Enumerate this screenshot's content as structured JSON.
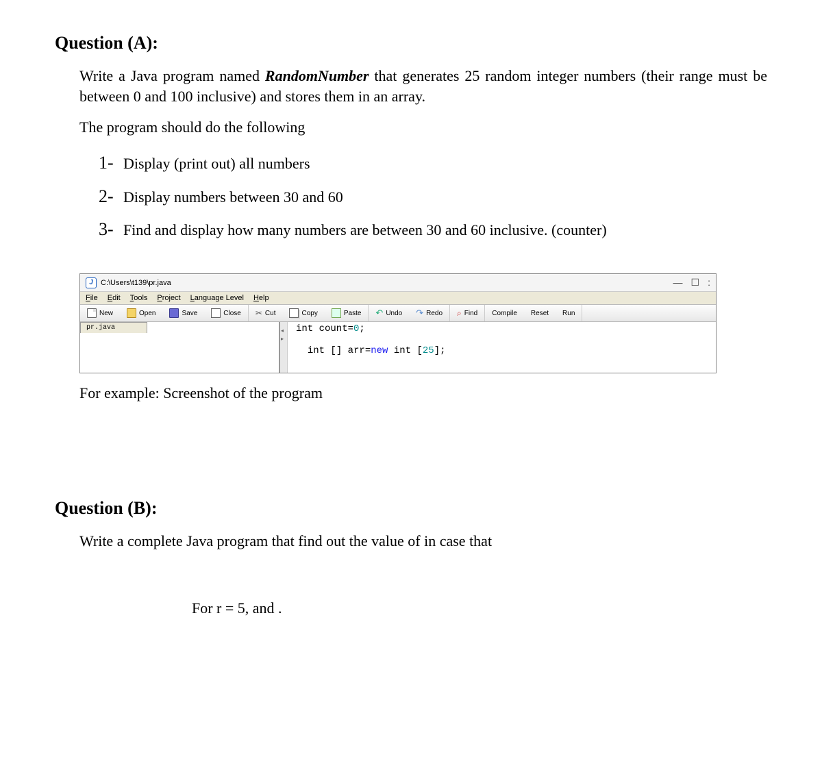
{
  "questionA": {
    "heading": "Question (A):",
    "para1_a": "Write a Java program named ",
    "program_name": "RandomNumber",
    "para1_b": " that generates 25 random integer numbers (their range must be between 0 and 100 inclusive) and stores them in an array.",
    "para2": "The program should do the following",
    "items": [
      {
        "num": "1",
        "text": "Display (print out) all numbers"
      },
      {
        "num": "2",
        "text": "Display numbers between 30 and 60"
      },
      {
        "num": "3",
        "text": "Find and display how many numbers are between 30 and 60 inclusive. (counter)"
      }
    ],
    "caption": "For example: Screenshot of the program"
  },
  "ide": {
    "title_path": "C:\\Users\\t139\\pr.java",
    "menu": [
      "File",
      "Edit",
      "Tools",
      "Project",
      "Language Level",
      "Help"
    ],
    "tools": {
      "new": "New",
      "open": "Open",
      "save": "Save",
      "close": "Close",
      "cut": "Cut",
      "copy": "Copy",
      "paste": "Paste",
      "undo": "Undo",
      "redo": "Redo",
      "find": "Find",
      "compile": "Compile",
      "reset": "Reset",
      "run": "Run"
    },
    "tab_label": "pr.java",
    "code_line1_a": "int count=",
    "code_line1_num": "0",
    "code_line1_b": ";",
    "code_line2_a": "int [] arr=",
    "code_line2_kw": "new",
    "code_line2_b": " int [",
    "code_line2_num": "25",
    "code_line2_c": "];",
    "win_controls": {
      "min": "—",
      "max": "☐",
      "close": ":"
    }
  },
  "questionB": {
    "heading": "Question (B):",
    "para": "Write a complete Java program that find out the value of  in case that",
    "for_r": "For r = 5, and ."
  }
}
